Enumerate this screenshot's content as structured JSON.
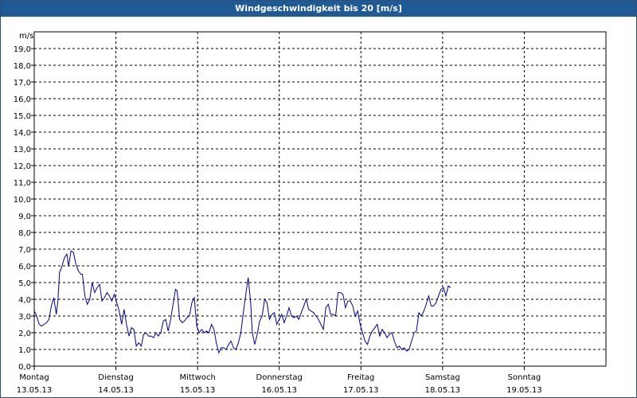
{
  "window": {
    "title": "Windgeschwindigkeit bis 20 [m/s]"
  },
  "chart_data": {
    "type": "line",
    "title": "Windgeschwindigkeit bis 20 [m/s]",
    "ylabel": "m/s",
    "xlabel": "",
    "ylim": [
      0,
      20
    ],
    "xlim": [
      0,
      7
    ],
    "grid": true,
    "y_ticks": [
      "0,0",
      "1,0",
      "2,0",
      "3,0",
      "4,0",
      "5,0",
      "6,0",
      "7,0",
      "8,0",
      "9,0",
      "10,0",
      "11,0",
      "12,0",
      "13,0",
      "14,0",
      "15,0",
      "16,0",
      "17,0",
      "18,0",
      "19,0"
    ],
    "x_ticks": [
      {
        "day": "Montag",
        "date": "13.05.13"
      },
      {
        "day": "Dienstag",
        "date": "14.05.13"
      },
      {
        "day": "Mittwoch",
        "date": "15.05.13"
      },
      {
        "day": "Donnerstag",
        "date": "16.05.13"
      },
      {
        "day": "Freitag",
        "date": "17.05.13"
      },
      {
        "day": "Samstag",
        "date": "18.05.13"
      },
      {
        "day": "Sonntag",
        "date": "19.05.13"
      }
    ],
    "colors": {
      "line": "#00008b",
      "grid": "#000000",
      "title_bar": "#1f5a94"
    },
    "series": [
      {
        "values": [
          [
            0.0,
            3.3
          ],
          [
            0.03,
            3.0
          ],
          [
            0.06,
            2.5
          ],
          [
            0.09,
            2.4
          ],
          [
            0.12,
            2.5
          ],
          [
            0.15,
            2.6
          ],
          [
            0.18,
            2.8
          ],
          [
            0.21,
            3.6
          ],
          [
            0.24,
            4.1
          ],
          [
            0.27,
            3.1
          ],
          [
            0.29,
            3.9
          ],
          [
            0.31,
            5.6
          ],
          [
            0.34,
            6.0
          ],
          [
            0.37,
            6.5
          ],
          [
            0.4,
            6.7
          ],
          [
            0.42,
            6.0
          ],
          [
            0.45,
            6.9
          ],
          [
            0.48,
            6.8
          ],
          [
            0.51,
            6.1
          ],
          [
            0.54,
            5.7
          ],
          [
            0.57,
            5.5
          ],
          [
            0.59,
            5.5
          ],
          [
            0.62,
            4.2
          ],
          [
            0.65,
            3.7
          ],
          [
            0.68,
            4.0
          ],
          [
            0.71,
            5.0
          ],
          [
            0.74,
            4.4
          ],
          [
            0.77,
            4.7
          ],
          [
            0.8,
            4.9
          ],
          [
            0.83,
            3.9
          ],
          [
            0.86,
            4.1
          ],
          [
            0.89,
            4.4
          ],
          [
            0.92,
            4.2
          ],
          [
            0.95,
            3.9
          ],
          [
            0.98,
            4.3
          ],
          [
            1.01,
            3.8
          ],
          [
            1.04,
            3.3
          ],
          [
            1.07,
            2.5
          ],
          [
            1.1,
            3.4
          ],
          [
            1.13,
            2.5
          ],
          [
            1.16,
            1.8
          ],
          [
            1.19,
            2.3
          ],
          [
            1.22,
            2.2
          ],
          [
            1.25,
            1.2
          ],
          [
            1.28,
            1.4
          ],
          [
            1.31,
            1.2
          ],
          [
            1.34,
            1.9
          ],
          [
            1.37,
            2.0
          ],
          [
            1.4,
            1.8
          ],
          [
            1.43,
            1.8
          ],
          [
            1.46,
            1.7
          ],
          [
            1.49,
            2.0
          ],
          [
            1.52,
            1.8
          ],
          [
            1.55,
            2.0
          ],
          [
            1.58,
            2.7
          ],
          [
            1.61,
            2.8
          ],
          [
            1.64,
            2.1
          ],
          [
            1.67,
            2.8
          ],
          [
            1.7,
            3.7
          ],
          [
            1.73,
            4.6
          ],
          [
            1.75,
            4.5
          ],
          [
            1.78,
            2.8
          ],
          [
            1.81,
            2.6
          ],
          [
            1.84,
            2.7
          ],
          [
            1.87,
            2.9
          ],
          [
            1.9,
            3.0
          ],
          [
            1.93,
            3.8
          ],
          [
            1.96,
            4.1
          ],
          [
            1.99,
            2.4
          ],
          [
            2.02,
            2.0
          ],
          [
            2.05,
            2.2
          ],
          [
            2.08,
            2.0
          ],
          [
            2.11,
            2.1
          ],
          [
            2.14,
            2.0
          ],
          [
            2.17,
            2.5
          ],
          [
            2.2,
            2.2
          ],
          [
            2.23,
            1.4
          ],
          [
            2.26,
            0.8
          ],
          [
            2.29,
            1.1
          ],
          [
            2.32,
            1.1
          ],
          [
            2.35,
            1.0
          ],
          [
            2.38,
            1.3
          ],
          [
            2.41,
            1.5
          ],
          [
            2.44,
            1.1
          ],
          [
            2.47,
            1.0
          ],
          [
            2.5,
            1.4
          ],
          [
            2.53,
            2.0
          ],
          [
            2.56,
            3.2
          ],
          [
            2.59,
            4.3
          ],
          [
            2.62,
            5.3
          ],
          [
            2.65,
            3.8
          ],
          [
            2.67,
            2.0
          ],
          [
            2.7,
            1.3
          ],
          [
            2.73,
            1.9
          ],
          [
            2.76,
            2.7
          ],
          [
            2.79,
            3.0
          ],
          [
            2.82,
            4.0
          ],
          [
            2.85,
            3.8
          ],
          [
            2.88,
            2.8
          ],
          [
            2.91,
            3.1
          ],
          [
            2.94,
            3.2
          ],
          [
            2.97,
            2.5
          ],
          [
            3.0,
            2.8
          ],
          [
            3.03,
            3.1
          ],
          [
            3.06,
            2.6
          ],
          [
            3.09,
            3.0
          ],
          [
            3.12,
            3.5
          ],
          [
            3.15,
            3.0
          ],
          [
            3.18,
            2.9
          ],
          [
            3.21,
            3.0
          ],
          [
            3.24,
            2.8
          ],
          [
            3.27,
            3.2
          ],
          [
            3.3,
            3.6
          ],
          [
            3.33,
            4.0
          ],
          [
            3.36,
            3.4
          ],
          [
            3.39,
            3.3
          ],
          [
            3.42,
            3.2
          ],
          [
            3.45,
            3.0
          ],
          [
            3.48,
            2.8
          ],
          [
            3.51,
            2.5
          ],
          [
            3.54,
            2.2
          ],
          [
            3.57,
            3.5
          ],
          [
            3.6,
            3.7
          ],
          [
            3.63,
            3.1
          ],
          [
            3.66,
            3.1
          ],
          [
            3.69,
            3.0
          ],
          [
            3.72,
            4.4
          ],
          [
            3.75,
            4.4
          ],
          [
            3.78,
            4.3
          ],
          [
            3.81,
            3.5
          ],
          [
            3.84,
            3.9
          ],
          [
            3.87,
            3.9
          ],
          [
            3.9,
            3.6
          ],
          [
            3.93,
            3.0
          ],
          [
            3.96,
            3.3
          ],
          [
            3.99,
            2.5
          ],
          [
            4.02,
            2.0
          ],
          [
            4.05,
            1.5
          ],
          [
            4.08,
            1.3
          ],
          [
            4.11,
            1.8
          ],
          [
            4.14,
            2.1
          ],
          [
            4.17,
            2.3
          ],
          [
            4.2,
            2.5
          ],
          [
            4.23,
            1.8
          ],
          [
            4.26,
            2.2
          ],
          [
            4.29,
            2.0
          ],
          [
            4.32,
            1.7
          ],
          [
            4.35,
            1.9
          ],
          [
            4.38,
            2.0
          ],
          [
            4.41,
            1.5
          ],
          [
            4.44,
            1.1
          ],
          [
            4.47,
            1.2
          ],
          [
            4.5,
            1.0
          ],
          [
            4.53,
            1.1
          ],
          [
            4.56,
            0.9
          ],
          [
            4.59,
            1.0
          ],
          [
            4.62,
            1.5
          ],
          [
            4.65,
            2.0
          ],
          [
            4.68,
            2.1
          ],
          [
            4.71,
            3.2
          ],
          [
            4.74,
            3.0
          ],
          [
            4.77,
            3.3
          ],
          [
            4.8,
            3.7
          ],
          [
            4.83,
            4.2
          ],
          [
            4.86,
            3.6
          ],
          [
            4.89,
            3.6
          ],
          [
            4.92,
            3.8
          ],
          [
            4.95,
            4.2
          ],
          [
            4.98,
            4.6
          ],
          [
            5.01,
            4.7
          ],
          [
            5.04,
            4.2
          ],
          [
            5.07,
            4.8
          ],
          [
            5.1,
            4.7
          ]
        ]
      }
    ]
  }
}
